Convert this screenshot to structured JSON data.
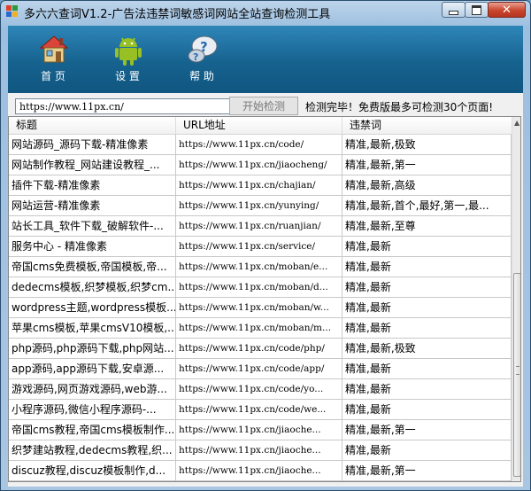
{
  "window": {
    "title": "多六六查词V1.2-广告法违禁词敏感词网站全站查询检测工具",
    "controls": {
      "minimize": "minimize",
      "maximize": "maximize",
      "close": "close"
    }
  },
  "toolbar": {
    "home_label": "首 页",
    "settings_label": "设 置",
    "help_label": "帮 助"
  },
  "search": {
    "url_value": "https://www.11px.cn/",
    "start_label": "开始检测",
    "status": "检测完毕！免费版最多可检测30个页面!"
  },
  "table": {
    "columns": [
      "标题",
      "URL地址",
      "违禁词"
    ],
    "rows": [
      [
        "网站源码_源码下载-精准像素",
        "https://www.11px.cn/code/",
        "精准,最新,极致"
      ],
      [
        "网站制作教程_网站建设教程_...",
        "https://www.11px.cn/jiaocheng/",
        "精准,最新,第一"
      ],
      [
        "插件下载-精准像素",
        "https://www.11px.cn/chajian/",
        "精准,最新,高级"
      ],
      [
        "网站运营-精准像素",
        "https://www.11px.cn/yunying/",
        "精准,最新,首个,最好,第一,最..."
      ],
      [
        "站长工具_软件下载_破解软件-...",
        "https://www.11px.cn/ruanjian/",
        "精准,最新,至尊"
      ],
      [
        "服务中心 - 精准像素",
        "https://www.11px.cn/service/",
        "精准,最新"
      ],
      [
        "帝国cms免费模板,帝国模板,帝...",
        "https://www.11px.cn/moban/e...",
        "精准,最新"
      ],
      [
        "dedecms模板,织梦模板,织梦cm...",
        "https://www.11px.cn/moban/d...",
        "精准,最新"
      ],
      [
        "wordpress主题,wordpress模板...",
        "https://www.11px.cn/moban/w...",
        "精准,最新"
      ],
      [
        "苹果cms模板,苹果cmsV10模板,...",
        "https://www.11px.cn/moban/m...",
        "精准,最新"
      ],
      [
        "php源码,php源码下载,php网站...",
        "https://www.11px.cn/code/php/",
        "精准,最新,极致"
      ],
      [
        "app源码,app源码下载,安卓源...",
        "https://www.11px.cn/code/app/",
        "精准,最新"
      ],
      [
        "游戏源码,网页游戏源码,web游...",
        "https://www.11px.cn/code/yo...",
        "精准,最新"
      ],
      [
        "小程序源码,微信小程序源码-...",
        "https://www.11px.cn/code/we...",
        "精准,最新"
      ],
      [
        "帝国cms教程,帝国cms模板制作...",
        "https://www.11px.cn/jiaoche...",
        "精准,最新,第一"
      ],
      [
        "织梦建站教程,dedecms教程,织...",
        "https://www.11px.cn/jiaoche...",
        "精准,最新"
      ],
      [
        "discuz教程,discuz模板制作,d...",
        "https://www.11px.cn/jiaoche...",
        "精准,最新,第一"
      ]
    ]
  }
}
